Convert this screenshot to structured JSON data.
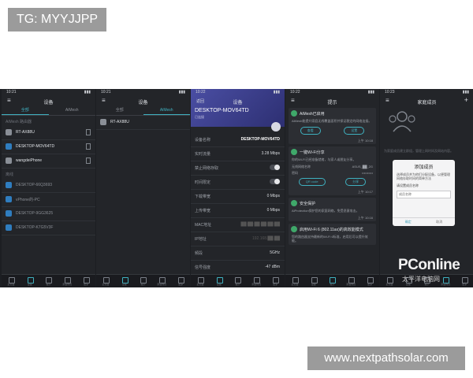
{
  "watermarks": {
    "top": "TG: MYYJJPP",
    "bottom": "www.nextpathsolar.com"
  },
  "logo": {
    "brand": "PConline",
    "sub": "太平洋电脑网"
  },
  "screens": [
    {
      "time": "10:21",
      "title": "设备",
      "tabs": [
        "全部",
        "AiMesh"
      ],
      "section1": "AiMesh 路由器",
      "devices1": [
        {
          "name": "RT-AX88U"
        },
        {
          "name": "DESKTOP-MOV64TD"
        },
        {
          "name": "wangdeiPhone"
        }
      ],
      "section2": "离线",
      "devices2": [
        {
          "name": "DESKTOP-66Q3693"
        },
        {
          "name": "vPhone的-PC"
        },
        {
          "name": "DESKTOP-9GG3625"
        },
        {
          "name": "DESKTOP-K7G5V3F"
        }
      ],
      "nav": [
        "主页面",
        "设备",
        "提示",
        "家庭成员",
        "更多"
      ]
    },
    {
      "time": "10:21",
      "title": "设备",
      "tabs": [
        "全部",
        "AiMesh"
      ],
      "devices": [
        {
          "name": "RT-AX88U"
        }
      ],
      "nav": [
        "主页面",
        "设备",
        "提示",
        "家庭成员",
        "更多"
      ]
    },
    {
      "time": "10:22",
      "title": "设备",
      "back": "返回",
      "device_name": "DESKTOP-MOV64TD",
      "device_sub": "已连接",
      "rows": [
        {
          "k": "设备名称",
          "v": "DESKTOP-MOV64TD"
        },
        {
          "k": "实时流量",
          "v": "3.28 Mbps"
        },
        {
          "k": "禁止网络存取",
          "v": ""
        },
        {
          "k": "时间限定",
          "v": ""
        },
        {
          "k": "下载带宽",
          "v": "0 Mbps"
        },
        {
          "k": "上传带宽",
          "v": "0 Mbps"
        },
        {
          "k": "MAC地址",
          "v": "██:██:██:██:██:██"
        },
        {
          "k": "IP地址",
          "v": "192.168.██.██"
        },
        {
          "k": "频段",
          "v": "5GHz"
        },
        {
          "k": "信号强度",
          "v": "-47 dBm"
        }
      ],
      "nav": [
        "主页面",
        "设备",
        "提示",
        "家庭成员",
        "更多"
      ]
    },
    {
      "time": "10:22",
      "title": "提示",
      "cards": [
        {
          "title": "AiMesh已启用",
          "text": "AiMesh能提升家庭无线覆盖面积并保证稳定的网络连接。",
          "buttons": [
            "查看",
            "设置"
          ],
          "meta": "上午 10:18"
        },
        {
          "title": "一键Wi-Fi分享",
          "text": "你的Wi-Fi已经准备就绪，与家人或朋友分享。",
          "fields": [
            {
              "k": "无线网络名称",
              "v": "ASUS_██_2G"
            },
            {
              "k": "密码",
              "v": "••••••••••"
            }
          ],
          "buttons": [
            "QR code",
            "分享"
          ],
          "meta": "上午 10:17"
        },
        {
          "title": "安全保护",
          "text": "AiProtection保护您的家庭网络，免受恶意攻击。",
          "meta": "上午 10:16"
        },
        {
          "title": "启用Wi-Fi 6 (802.11ax)的高效能模式",
          "text": "您的路由器支持最新的Wi-Fi 6标准，启用后可以提升效能。",
          "meta": "上午 10:15"
        }
      ],
      "nav": [
        "主页面",
        "设备",
        "提示",
        "家庭成员",
        "更多"
      ]
    },
    {
      "time": "10:23",
      "title": "家庭成员",
      "hint": "为家庭成员建立群组，管理上网时间及网站内容。",
      "dialog": {
        "title": "添加成员",
        "desc": "选择成员并为他们分配设备，以便管理网络存取时间的简单方法",
        "label": "请设置成员名称",
        "placeholder": "成员名称",
        "ok": "确定",
        "cancel": "取消"
      },
      "nav": [
        "主页面",
        "设备",
        "提示",
        "家庭成员",
        "更多"
      ]
    }
  ]
}
